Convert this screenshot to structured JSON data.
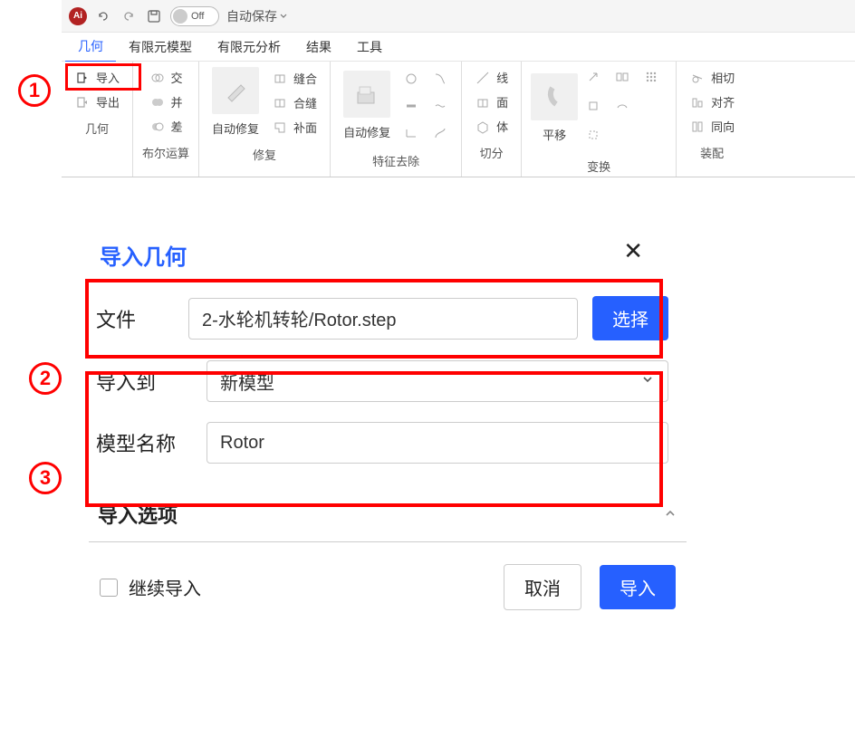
{
  "titlebar": {
    "autosave_off": "Off",
    "autosave_label": "自动保存"
  },
  "menubar": {
    "items": [
      {
        "label": "几何",
        "active": true
      },
      {
        "label": "有限元模型"
      },
      {
        "label": "有限元分析"
      },
      {
        "label": "结果"
      },
      {
        "label": "工具"
      }
    ]
  },
  "ribbon": {
    "group_geometry": {
      "import": "导入",
      "export": "导出",
      "label": "几何"
    },
    "group_boolean": {
      "intersect": "交",
      "union": "并",
      "subtract": "差",
      "label": "布尔运算"
    },
    "group_repair": {
      "auto_repair": "自动修复",
      "stitch": "缝合",
      "seam": "合缝",
      "patch": "补面",
      "label": "修复"
    },
    "group_feature_remove": {
      "auto_repair": "自动修复",
      "label": "特征去除"
    },
    "group_split": {
      "line": "线",
      "face": "面",
      "body": "体",
      "label": "切分"
    },
    "group_transform": {
      "translate": "平移",
      "label": "变换"
    },
    "group_assembly": {
      "tangent": "相切",
      "align": "对齐",
      "coincident": "同向",
      "label": "装配"
    }
  },
  "dialog": {
    "title": "导入几何",
    "file_label": "文件",
    "file_value": "2-水轮机转轮/Rotor.step",
    "choose": "选择",
    "import_to_label": "导入到",
    "import_to_value": "新模型",
    "model_name_label": "模型名称",
    "model_name_value": "Rotor",
    "options_label": "导入选项",
    "continue_import": "继续导入",
    "cancel": "取消",
    "import": "导入"
  },
  "annotations": {
    "a1": "1",
    "a2": "2",
    "a3": "3"
  }
}
